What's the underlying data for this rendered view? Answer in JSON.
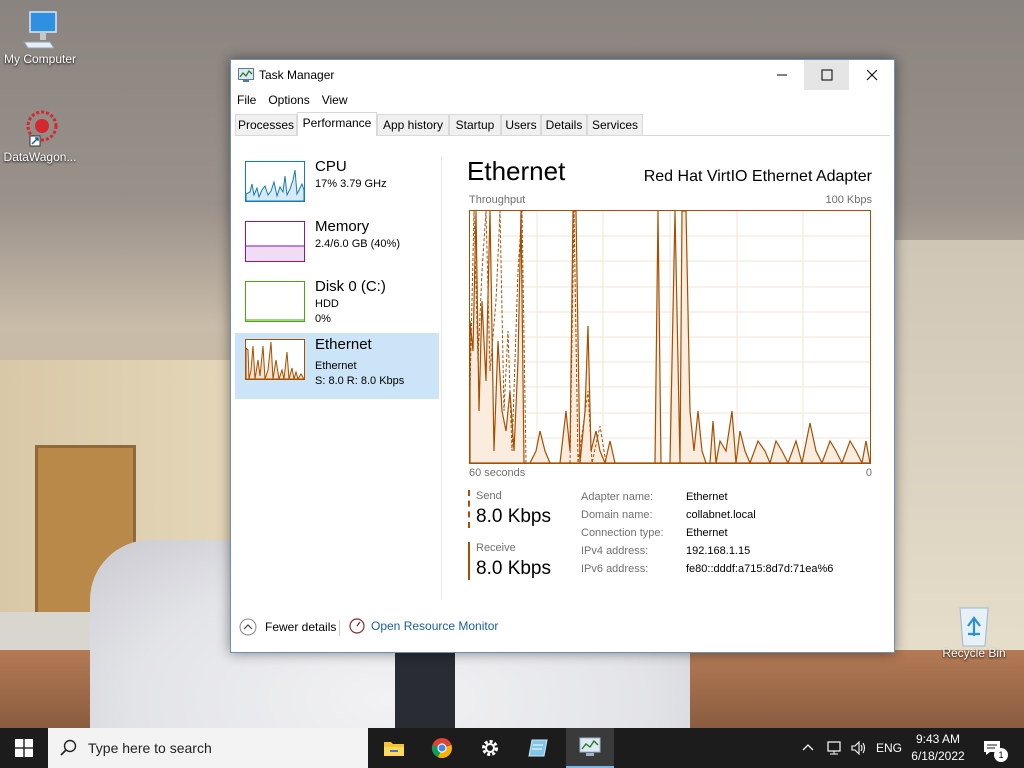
{
  "desktop": {
    "icons": [
      {
        "label": "My Computer",
        "icon": "computer-icon"
      },
      {
        "label": "DataWagon...",
        "icon": "datawagon-icon"
      },
      {
        "label": "Recycle Bin",
        "icon": "recycle-bin-icon"
      }
    ]
  },
  "window": {
    "title": "Task Manager",
    "menu": [
      "File",
      "Options",
      "View"
    ],
    "tabs": [
      "Processes",
      "Performance",
      "App history",
      "Startup",
      "Users",
      "Details",
      "Services"
    ],
    "active_tab": "Performance"
  },
  "sidebar": {
    "items": [
      {
        "name": "CPU",
        "line1": "17%  3.79 GHz",
        "line2": "",
        "color": "#117dbb"
      },
      {
        "name": "Memory",
        "line1": "2.4/6.0 GB (40%)",
        "line2": "",
        "color": "#8b12ae"
      },
      {
        "name": "Disk 0 (C:)",
        "line1": "HDD",
        "line2": "0%",
        "color": "#4da60c"
      },
      {
        "name": "Ethernet",
        "line1": "Ethernet",
        "line2": "S: 8.0  R: 8.0 Kbps",
        "color": "#a74f01",
        "selected": true
      }
    ]
  },
  "detail": {
    "title": "Ethernet",
    "adapter": "Red Hat VirtIO Ethernet Adapter",
    "throughput_label": "Throughput",
    "max_label": "100 Kbps",
    "time_left": "60 seconds",
    "time_right": "0",
    "send_label": "Send",
    "send_value": "8.0 Kbps",
    "receive_label": "Receive",
    "receive_value": "8.0 Kbps",
    "properties": [
      {
        "key": "Adapter name:",
        "value": "Ethernet"
      },
      {
        "key": "Domain name:",
        "value": "collabnet.local"
      },
      {
        "key": "Connection type:",
        "value": "Ethernet"
      },
      {
        "key": "IPv4 address:",
        "value": "192.168.1.15"
      },
      {
        "key": "IPv6 address:",
        "value": "fe80::dddf:a715:8d7d:71ea%6"
      }
    ]
  },
  "footer": {
    "fewer_details": "Fewer details",
    "open_resource_monitor": "Open Resource Monitor"
  },
  "taskbar": {
    "search_placeholder": "Type here to search",
    "language": "ENG",
    "time": "9:43 AM",
    "date": "6/18/2022",
    "notification_count": "1",
    "apps": [
      "file-explorer-icon",
      "chrome-icon",
      "settings-icon",
      "notepad-icon",
      "task-manager-icon"
    ]
  }
}
